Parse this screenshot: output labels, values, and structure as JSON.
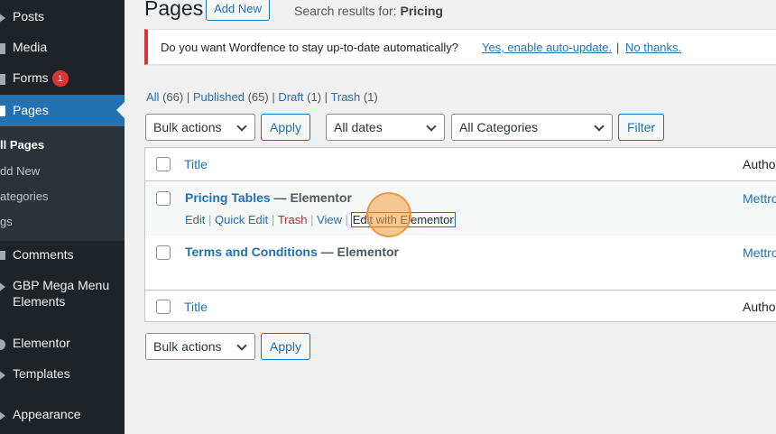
{
  "sidebar": {
    "items": [
      {
        "label": "Posts",
        "icon": "pin-icon"
      },
      {
        "label": "Media",
        "icon": "media-icon"
      },
      {
        "label": "Forms",
        "icon": "forms-icon",
        "badge": "1"
      },
      {
        "label": "Pages",
        "icon": "pages-icon"
      },
      {
        "label": "Comments",
        "icon": "comments-icon"
      },
      {
        "label": "GBP Mega Menu",
        "label2": "Elements",
        "icon": "gbp-icon"
      },
      {
        "label": "Elementor",
        "icon": "elementor-icon"
      },
      {
        "label": "Templates",
        "icon": "templates-icon"
      },
      {
        "label": "Appearance",
        "icon": "appearance-icon"
      }
    ],
    "submenu": [
      "ll Pages",
      "dd New",
      "ategories",
      "gs"
    ]
  },
  "header": {
    "title": "Pages",
    "add_new": "Add New",
    "search_prefix": "Search results for: ",
    "search_term": "Pricing"
  },
  "notice": {
    "text": "Do you want Wordfence to stay up-to-date automatically?",
    "yes": "Yes, enable auto-update.",
    "sep": "|",
    "no": "No thanks."
  },
  "views": {
    "all": "All",
    "all_count": "(66)",
    "published": "Published",
    "published_count": "(65)",
    "draft": "Draft",
    "draft_count": "(1)",
    "trash": "Trash",
    "trash_count": "(1)",
    "sep": "|"
  },
  "filters": {
    "bulk_actions": "Bulk actions",
    "apply": "Apply",
    "dates": "All dates",
    "categories": "All Categories",
    "filter": "Filter"
  },
  "table": {
    "col_title": "Title",
    "col_author": "Autho",
    "rows": [
      {
        "title": "Pricing Tables",
        "state": " — Elementor",
        "author": "Mettro"
      },
      {
        "title": "Terms and Conditions",
        "state": " — Elementor",
        "author": "Mettro"
      }
    ],
    "actions": {
      "edit": "Edit",
      "quick_edit": "Quick Edit",
      "trash": "Trash",
      "view": "View",
      "edit_elementor": "Edit with Elementor",
      "sep": "|"
    }
  },
  "colors": {
    "sidebar": "#1d2327",
    "accent": "#2271b1",
    "badge": "#d63638"
  }
}
